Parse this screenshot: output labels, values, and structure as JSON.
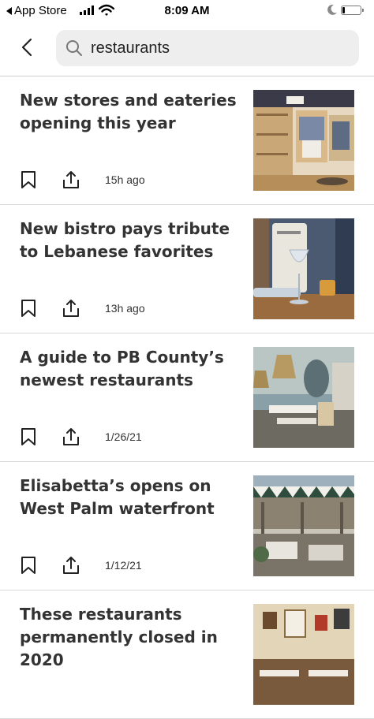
{
  "status_bar": {
    "carrier": "App Store",
    "time": "8:09 AM",
    "battery_level": 0.15
  },
  "header": {
    "search_value": "restaurants"
  },
  "articles": [
    {
      "title": "New stores and eateries opening this year",
      "time": "15h ago",
      "image_subject": "clothing store interior"
    },
    {
      "title": "New bistro pays tribute to Lebanese favorites",
      "time": "13h ago",
      "image_subject": "wine glass on restaurant table"
    },
    {
      "title": "A guide to PB County’s newest restaurants",
      "time": "1/26/21",
      "image_subject": "restaurant dining room with rattan lamps"
    },
    {
      "title": "Elisabetta’s opens on West Palm waterfront",
      "time": "1/12/21",
      "image_subject": "outdoor patio with striped awning"
    },
    {
      "title": "These restaurants permanently closed in 2020",
      "time": "",
      "image_subject": "restaurant interior with framed art"
    }
  ],
  "colors": {
    "text": "#333333",
    "search_bg": "#eeeeee",
    "divider": "#d8d8d8"
  }
}
